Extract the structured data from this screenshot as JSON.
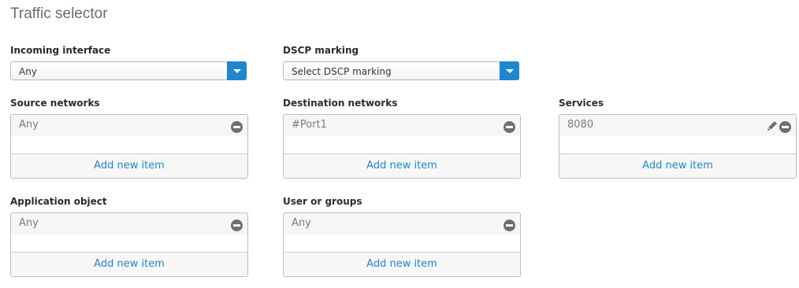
{
  "section_title": "Traffic selector",
  "incoming_interface": {
    "label": "Incoming interface",
    "value": "Any"
  },
  "dscp_marking": {
    "label": "DSCP marking",
    "value": "Select DSCP marking"
  },
  "source_networks": {
    "label": "Source networks",
    "item": "Any",
    "add": "Add new item"
  },
  "destination_networks": {
    "label": "Destination networks",
    "item": "#Port1",
    "add": "Add new item"
  },
  "services": {
    "label": "Services",
    "item": "8080",
    "add": "Add new item"
  },
  "application_object": {
    "label": "Application object",
    "item": "Any",
    "add": "Add new item"
  },
  "user_or_groups": {
    "label": "User or groups",
    "item": "Any",
    "add": "Add new item"
  },
  "colors": {
    "accent": "#1f86cf",
    "remove_icon": "#6f6f6f"
  },
  "icons": [
    "chevron-down-icon",
    "remove-icon",
    "edit-pencil-icon"
  ]
}
